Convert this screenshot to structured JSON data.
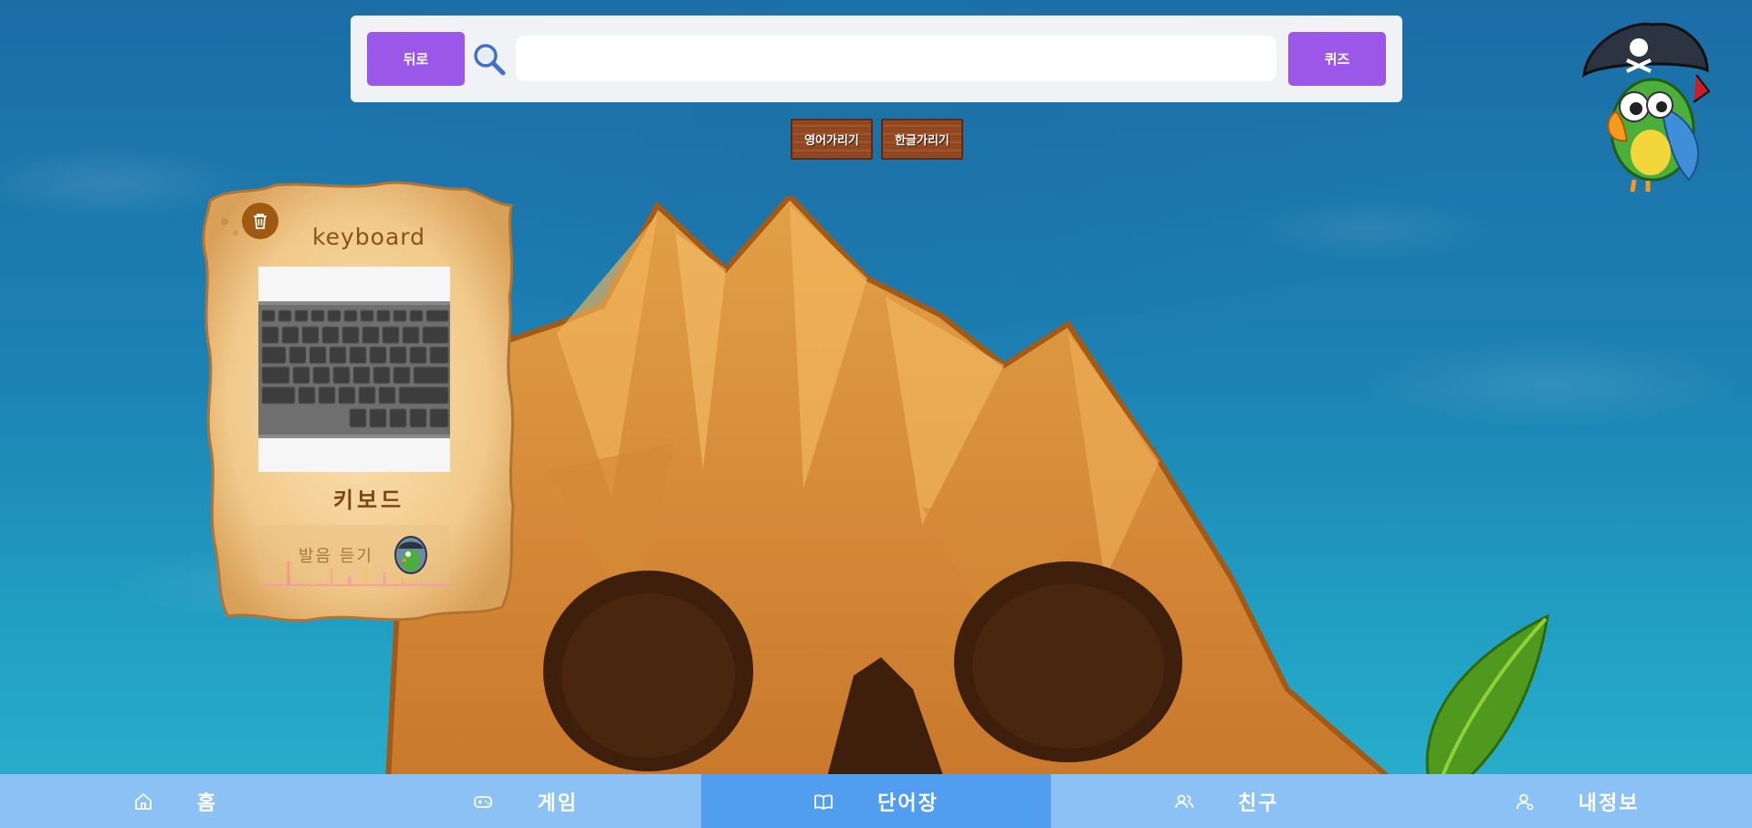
{
  "topbar": {
    "back_label": "뒤로",
    "quiz_label": "퀴즈",
    "search_value": "",
    "search_placeholder": ""
  },
  "toggles": {
    "hide_english": "영어가리기",
    "hide_korean": "한글가리기"
  },
  "card": {
    "word": "keyboard",
    "meaning": "키보드",
    "listen_label": "발음 듣기",
    "image_subject": "keyboard-photo"
  },
  "nav": {
    "items": [
      {
        "label": "홈",
        "icon": "home-icon",
        "active": false
      },
      {
        "label": "게임",
        "icon": "gamepad-icon",
        "active": false
      },
      {
        "label": "단어장",
        "icon": "book-icon",
        "active": true
      },
      {
        "label": "친구",
        "icon": "friends-icon",
        "active": false
      },
      {
        "label": "내정보",
        "icon": "user-icon",
        "active": false
      }
    ]
  },
  "colors": {
    "accent_purple": "#9a57e8",
    "nav_bg": "#8cc1f6",
    "nav_active": "#519df0"
  }
}
